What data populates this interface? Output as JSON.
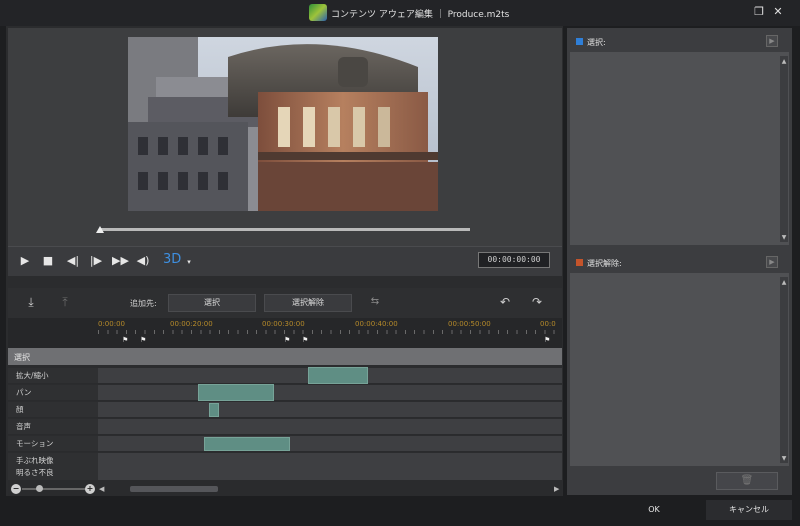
{
  "window": {
    "title": "コンテンツ アウェア編集 ｜ Produce.m2ts"
  },
  "player": {
    "timecode": "00:00:00:00"
  },
  "toolbar": {
    "add_to_label": "追加先:",
    "select_label": "選択",
    "deselect_label": "選択解除"
  },
  "ruler": {
    "ticks": [
      "0:00:00",
      "00:00:20:00",
      "00:00:30:00",
      "00:00:40:00",
      "00:00:50:00",
      "00:0"
    ]
  },
  "tracks": {
    "section_label": "選択",
    "rows": [
      {
        "name": "拡大/縮小"
      },
      {
        "name": "パン"
      },
      {
        "name": "顔"
      },
      {
        "name": "音声"
      },
      {
        "name": "モーション"
      },
      {
        "name": "手ぶれ映像"
      },
      {
        "name": "明るさ不良"
      }
    ]
  },
  "side_panels": {
    "select_title": "選択:",
    "deselect_title": "選択解除:",
    "select_color": "#2f7fd8",
    "deselect_color": "#c4542b"
  },
  "dialog": {
    "ok_label": "OK",
    "cancel_label": "キャンセル"
  },
  "colors": {
    "clip": "#5f8e84",
    "timecode_ticks": "#b58a2a"
  }
}
